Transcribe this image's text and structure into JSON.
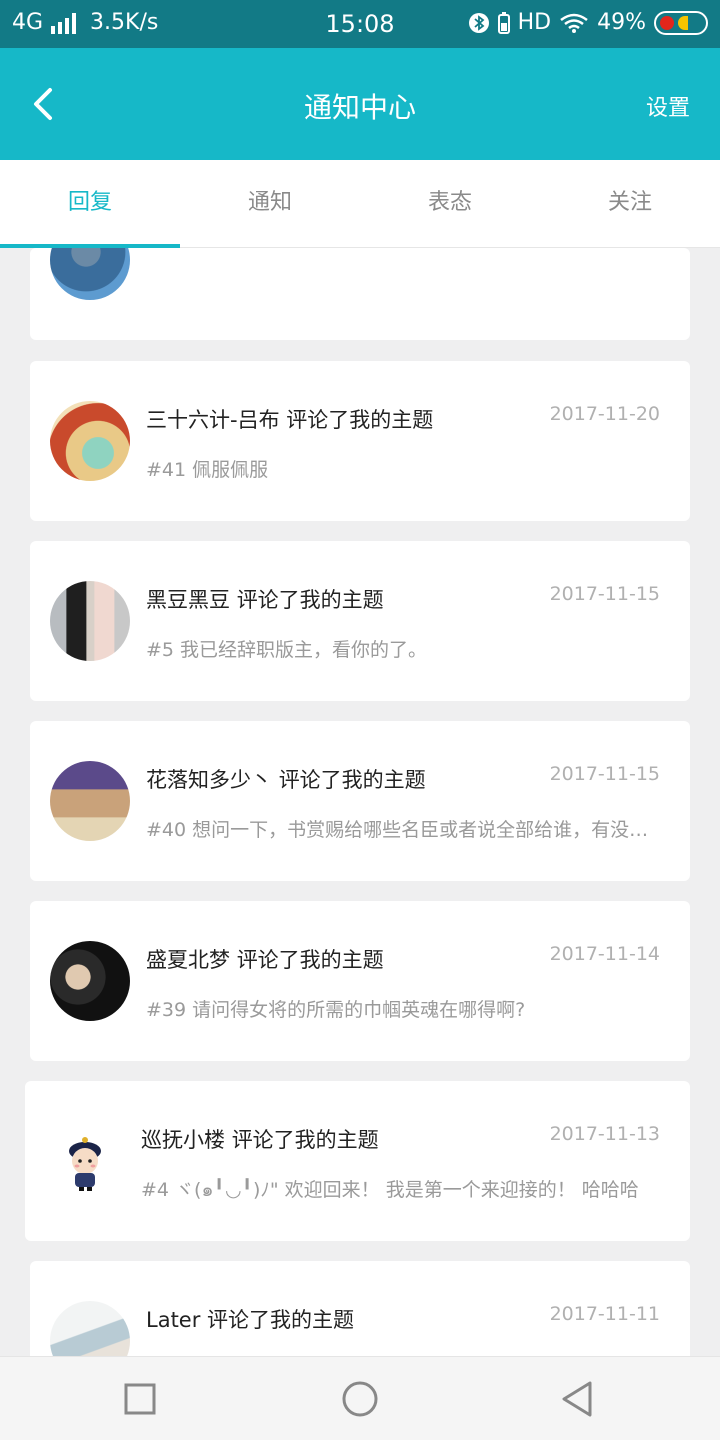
{
  "status_bar": {
    "network": "4G",
    "speed": "3.5K/s",
    "time": "15:08",
    "hd": "HD",
    "battery": "49%"
  },
  "nav": {
    "title": "通知中心",
    "settings_label": "设置",
    "back_icon": "chevron-left-icon"
  },
  "tabs": [
    {
      "label": "回复",
      "active": true
    },
    {
      "label": "通知",
      "active": false
    },
    {
      "label": "表态",
      "active": false
    },
    {
      "label": "关注",
      "active": false
    }
  ],
  "notifications": [
    {
      "user": "三十六计-吕布",
      "action": "评论了我的主题",
      "date": "2017-11-20",
      "message": "#41 佩服佩服"
    },
    {
      "user": "黑豆黑豆",
      "action": "评论了我的主题",
      "date": "2017-11-15",
      "message": "#5 我已经辞职版主，看你的了。"
    },
    {
      "user": "花落知多少丶",
      "action": "评论了我的主题",
      "date": "2017-11-15",
      "message": "#40 想问一下，书赏赐给哪些名臣或者说全部给谁，有没有..."
    },
    {
      "user": "盛夏北梦",
      "action": "评论了我的主题",
      "date": "2017-11-14",
      "message": "#39 请问得女将的所需的巾帼英魂在哪得啊?"
    },
    {
      "user": "巡抚小楼",
      "action": "评论了我的主题",
      "date": "2017-11-13",
      "message": "#4 ヾ(๑╹◡╹)ﾉ\" 欢迎回来！ 我是第一个来迎接的！ 哈哈哈"
    },
    {
      "user": "Later",
      "action": "评论了我的主题",
      "date": "2017-11-11",
      "message": ""
    }
  ],
  "colors": {
    "accent": "#16b8c8",
    "status_bar": "#127a86",
    "background": "#efeff0"
  }
}
